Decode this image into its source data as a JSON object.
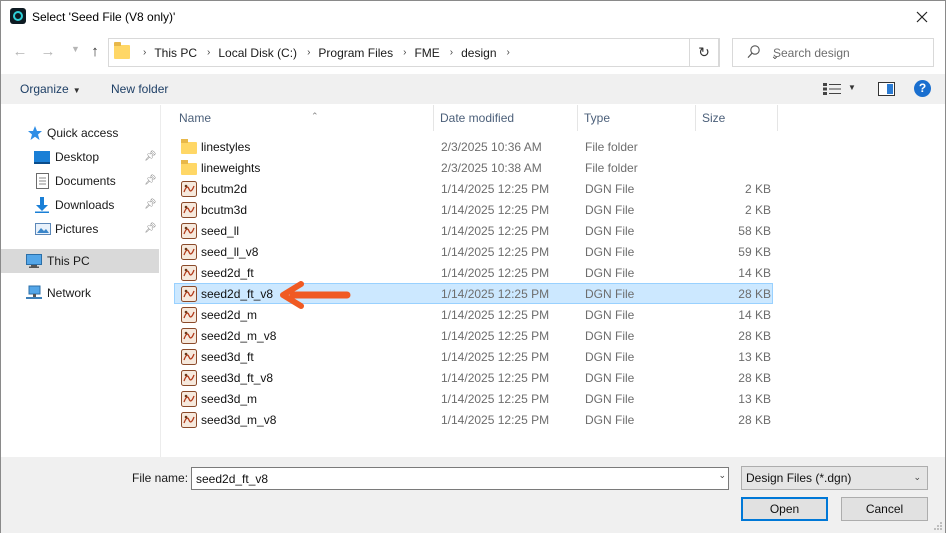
{
  "window": {
    "title": "Select 'Seed File (V8 only)'"
  },
  "breadcrumb": [
    "This PC",
    "Local Disk (C:)",
    "Program Files",
    "FME",
    "design"
  ],
  "search": {
    "placeholder": "Search design"
  },
  "toolbar": {
    "organize_label": "Organize",
    "new_folder_label": "New folder"
  },
  "sidebar": {
    "items": [
      {
        "label": "Quick access",
        "icon": "star-icon",
        "pinned": false
      },
      {
        "label": "Desktop",
        "icon": "desktop-icon",
        "pinned": true
      },
      {
        "label": "Documents",
        "icon": "documents-icon",
        "pinned": true
      },
      {
        "label": "Downloads",
        "icon": "download-icon",
        "pinned": true
      },
      {
        "label": "Pictures",
        "icon": "pictures-icon",
        "pinned": true
      },
      {
        "label": "This PC",
        "icon": "computer-icon",
        "pinned": false,
        "selected": true
      },
      {
        "label": "Network",
        "icon": "network-icon",
        "pinned": false
      }
    ]
  },
  "columns": {
    "name": "Name",
    "date": "Date modified",
    "type": "Type",
    "size": "Size"
  },
  "files": [
    {
      "name": "linestyles",
      "date": "2/3/2025 10:36 AM",
      "type": "File folder",
      "size": "",
      "kind": "folder"
    },
    {
      "name": "lineweights",
      "date": "2/3/2025 10:38 AM",
      "type": "File folder",
      "size": "",
      "kind": "folder"
    },
    {
      "name": "bcutm2d",
      "date": "1/14/2025 12:25 PM",
      "type": "DGN File",
      "size": "2 KB",
      "kind": "dgn"
    },
    {
      "name": "bcutm3d",
      "date": "1/14/2025 12:25 PM",
      "type": "DGN File",
      "size": "2 KB",
      "kind": "dgn"
    },
    {
      "name": "seed_ll",
      "date": "1/14/2025 12:25 PM",
      "type": "DGN File",
      "size": "58 KB",
      "kind": "dgn"
    },
    {
      "name": "seed_ll_v8",
      "date": "1/14/2025 12:25 PM",
      "type": "DGN File",
      "size": "59 KB",
      "kind": "dgn"
    },
    {
      "name": "seed2d_ft",
      "date": "1/14/2025 12:25 PM",
      "type": "DGN File",
      "size": "14 KB",
      "kind": "dgn"
    },
    {
      "name": "seed2d_ft_v8",
      "date": "1/14/2025 12:25 PM",
      "type": "DGN File",
      "size": "28 KB",
      "kind": "dgn",
      "selected": true
    },
    {
      "name": "seed2d_m",
      "date": "1/14/2025 12:25 PM",
      "type": "DGN File",
      "size": "14 KB",
      "kind": "dgn"
    },
    {
      "name": "seed2d_m_v8",
      "date": "1/14/2025 12:25 PM",
      "type": "DGN File",
      "size": "28 KB",
      "kind": "dgn"
    },
    {
      "name": "seed3d_ft",
      "date": "1/14/2025 12:25 PM",
      "type": "DGN File",
      "size": "13 KB",
      "kind": "dgn"
    },
    {
      "name": "seed3d_ft_v8",
      "date": "1/14/2025 12:25 PM",
      "type": "DGN File",
      "size": "28 KB",
      "kind": "dgn"
    },
    {
      "name": "seed3d_m",
      "date": "1/14/2025 12:25 PM",
      "type": "DGN File",
      "size": "13 KB",
      "kind": "dgn"
    },
    {
      "name": "seed3d_m_v8",
      "date": "1/14/2025 12:25 PM",
      "type": "DGN File",
      "size": "28 KB",
      "kind": "dgn"
    }
  ],
  "footer": {
    "file_name_label": "File name:",
    "file_name_value": "seed2d_ft_v8",
    "filter": "Design Files (*.dgn)",
    "open_label": "Open",
    "cancel_label": "Cancel"
  },
  "colors": {
    "accent": "#0078d7",
    "selection": "#cce8ff",
    "annotation_arrow": "#f05a23"
  }
}
